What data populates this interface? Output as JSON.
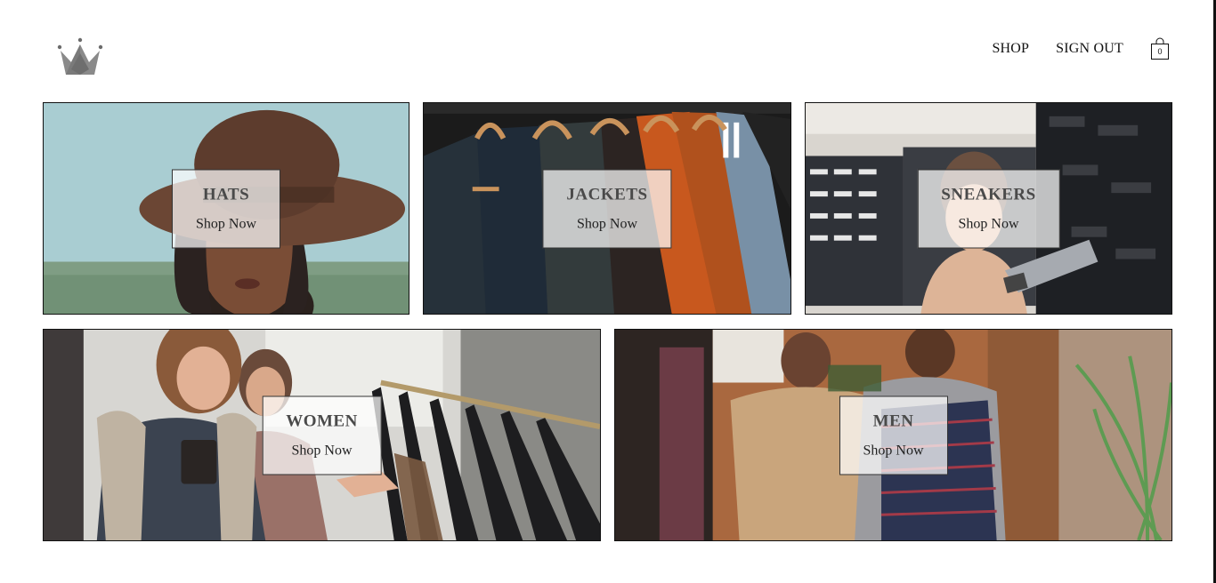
{
  "header": {
    "logo_icon": "crown-icon",
    "nav": [
      {
        "label": "SHOP"
      },
      {
        "label": "SIGN OUT"
      }
    ],
    "cart": {
      "icon": "shopping-bag-icon",
      "count": "0"
    }
  },
  "directory": {
    "items": [
      {
        "title": "HATS",
        "subtitle": "Shop Now"
      },
      {
        "title": "JACKETS",
        "subtitle": "Shop Now"
      },
      {
        "title": "SNEAKERS",
        "subtitle": "Shop Now"
      },
      {
        "title": "WOMEN",
        "subtitle": "Shop Now"
      },
      {
        "title": "MEN",
        "subtitle": "Shop Now"
      }
    ]
  },
  "colors": {
    "page_bg": "#ffffff",
    "border": "#111111",
    "label_bg": "rgba(255,255,255,0.72)",
    "title_text": "#4a4a4a"
  }
}
